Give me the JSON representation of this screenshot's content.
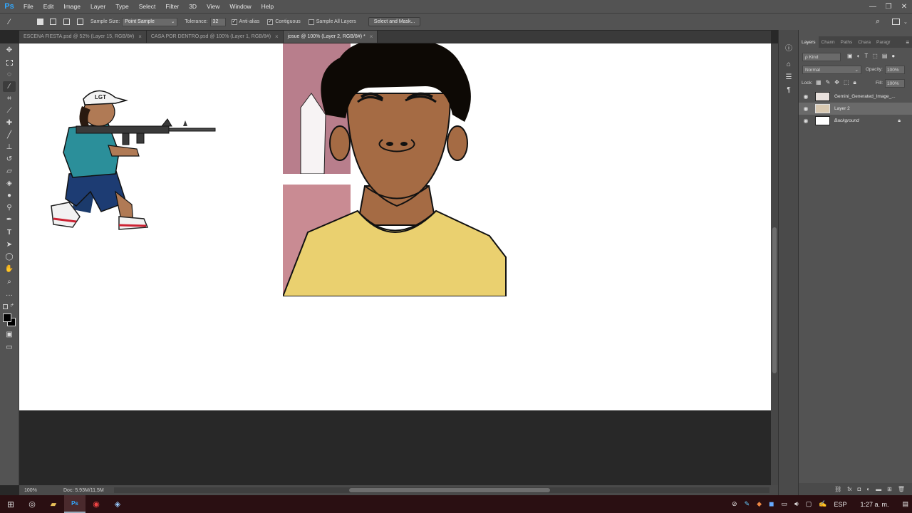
{
  "app": {
    "logo": "Ps"
  },
  "menu": [
    "File",
    "Edit",
    "Image",
    "Layer",
    "Type",
    "Select",
    "Filter",
    "3D",
    "View",
    "Window",
    "Help"
  ],
  "window_controls": {
    "minimize": "—",
    "restore": "❐",
    "close": "✕"
  },
  "options": {
    "sample_size_label": "Sample Size:",
    "sample_size_value": "Point Sample",
    "tolerance_label": "Tolerance:",
    "tolerance_value": "32",
    "anti_alias": "Anti-alias",
    "contiguous": "Contiguous",
    "sample_all_layers": "Sample All Layers",
    "select_and_mask": "Select and Mask..."
  },
  "tabs": [
    {
      "label": "ESCENA FIESTA.psd @ 52% (Layer 15, RGB/8#)",
      "close": "×"
    },
    {
      "label": "CASA POR DENTRO.psd @ 100% (Layer 1, RGB/8#)",
      "close": "×"
    },
    {
      "label": "josue @ 100% (Layer 2, RGB/8#) *",
      "close": "×"
    }
  ],
  "status": {
    "zoom": "100%",
    "doc": "Doc: 5.93M/11.5M",
    "arrow": "›"
  },
  "panel": {
    "tabs": [
      "Layers",
      "Chann",
      "Paths",
      "Chara",
      "Paragr"
    ],
    "kind_label": "ρ Kind",
    "blend_mode": "Normal",
    "opacity_label": "Opacity:",
    "opacity_value": "100%",
    "lock_label": "Lock:",
    "fill_label": "Fill:",
    "fill_value": "100%",
    "layers": [
      {
        "name": "Gemini_Generated_Image_..."
      },
      {
        "name": "Layer 2"
      },
      {
        "name": "Background"
      }
    ]
  },
  "taskbar": {
    "lang": "ESP",
    "time": "1:27 a. m."
  },
  "colors": {
    "ui_bg": "#535353",
    "canvas": "#ffffff",
    "taskbar": "#2a0f12",
    "shirt": "#ead06f",
    "skin": "#a56b44"
  }
}
